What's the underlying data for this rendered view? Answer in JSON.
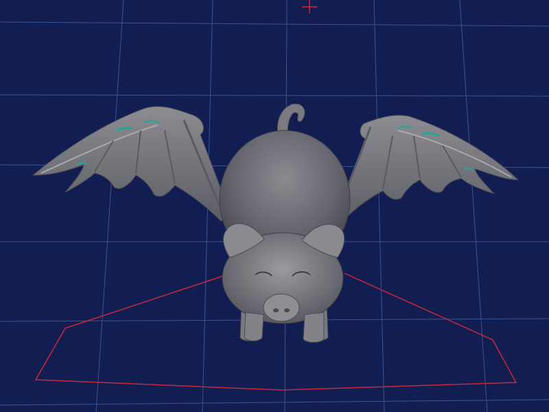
{
  "viewport": {
    "background": "#121e52",
    "grid_color": "#3f5a9c",
    "bed_outline_color": "#c8283c",
    "origin_marker_color": "#e02030"
  },
  "model": {
    "description_icon": "winged-pig-model",
    "body_color": "#6e6e72",
    "highlight_color": "#9a9aa0",
    "shadow_color": "#3e3e44",
    "wing_accent_color": "#1fa89a"
  }
}
